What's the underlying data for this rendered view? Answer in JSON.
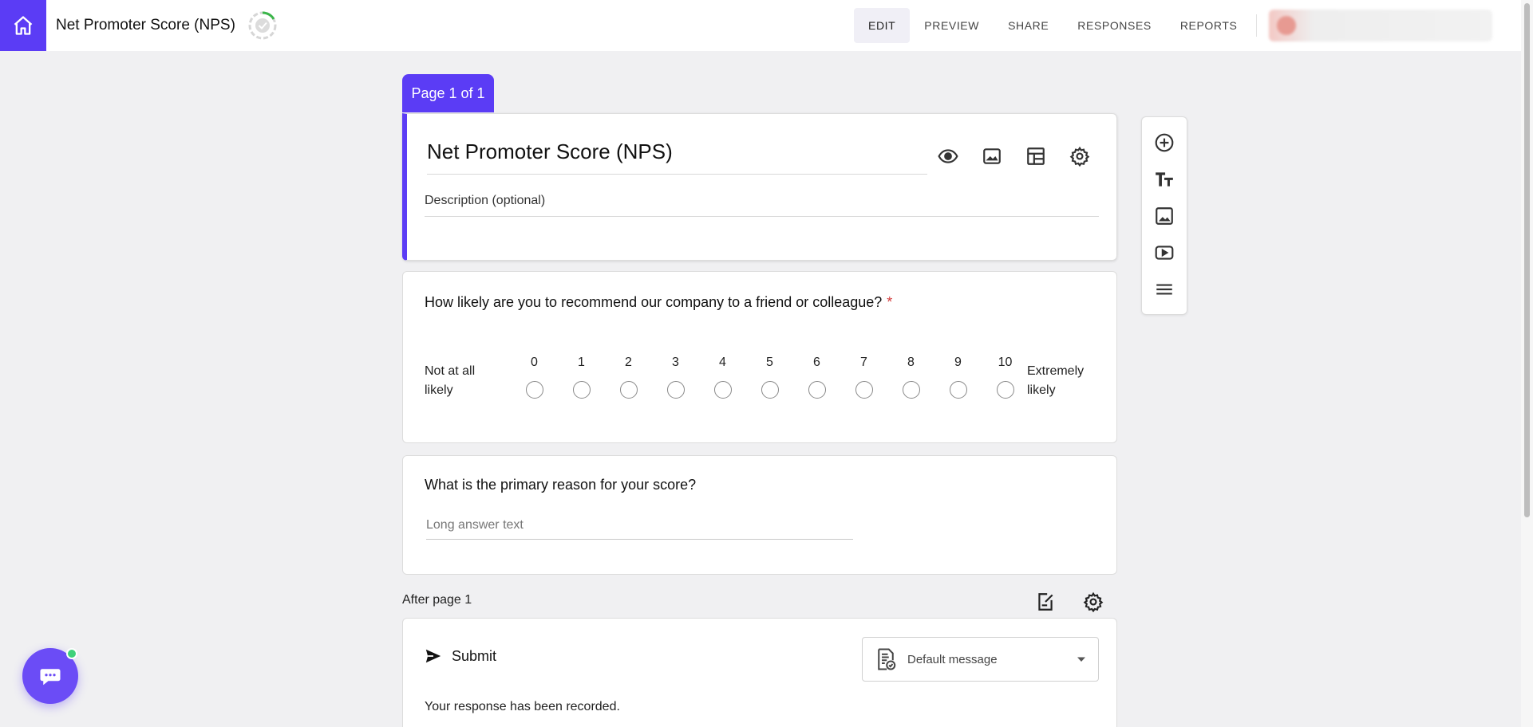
{
  "app": {
    "form_title": "Net Promoter Score (NPS)",
    "accent_color": "#5b3cf5"
  },
  "nav": {
    "tabs": [
      {
        "label": "EDIT",
        "active": true
      },
      {
        "label": "PREVIEW",
        "active": false
      },
      {
        "label": "SHARE",
        "active": false
      },
      {
        "label": "RESPONSES",
        "active": false
      },
      {
        "label": "REPORTS",
        "active": false
      }
    ]
  },
  "page_tab": {
    "label": "Page 1 of 1"
  },
  "header_card": {
    "title": "Net Promoter Score (NPS)",
    "description_placeholder": "Description (optional)",
    "icons": [
      "eye-icon",
      "image-icon",
      "layout-icon",
      "gear-icon"
    ]
  },
  "question1": {
    "text": "How likely are you to recommend our company to a friend or colleague?",
    "required_mark": "*",
    "left_label": "Not at all likely",
    "right_label": "Extremely likely",
    "scale": [
      "0",
      "1",
      "2",
      "3",
      "4",
      "5",
      "6",
      "7",
      "8",
      "9",
      "10"
    ]
  },
  "question2": {
    "text": "What is the primary reason for your score?",
    "placeholder": "Long answer text"
  },
  "after_page": {
    "label": "After page 1"
  },
  "submit_card": {
    "label": "Submit",
    "message_select": "Default message",
    "confirmation": "Your response has been recorded."
  },
  "toolbar": {
    "icons": [
      "add-question-icon",
      "title-text-icon",
      "add-image-icon",
      "add-video-icon",
      "add-section-icon"
    ]
  }
}
